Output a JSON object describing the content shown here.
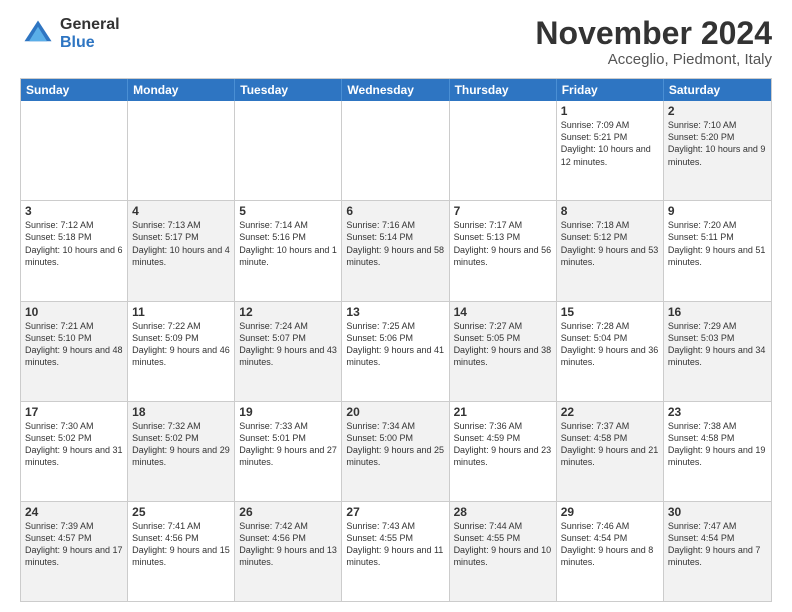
{
  "logo": {
    "line1": "General",
    "line2": "Blue"
  },
  "header": {
    "month": "November 2024",
    "location": "Acceglio, Piedmont, Italy"
  },
  "weekdays": [
    "Sunday",
    "Monday",
    "Tuesday",
    "Wednesday",
    "Thursday",
    "Friday",
    "Saturday"
  ],
  "rows": [
    [
      {
        "day": "",
        "info": "",
        "empty": true
      },
      {
        "day": "",
        "info": "",
        "empty": true
      },
      {
        "day": "",
        "info": "",
        "empty": true
      },
      {
        "day": "",
        "info": "",
        "empty": true
      },
      {
        "day": "",
        "info": "",
        "empty": true
      },
      {
        "day": "1",
        "info": "Sunrise: 7:09 AM\nSunset: 5:21 PM\nDaylight: 10 hours and 12 minutes."
      },
      {
        "day": "2",
        "info": "Sunrise: 7:10 AM\nSunset: 5:20 PM\nDaylight: 10 hours and 9 minutes.",
        "shaded": true
      }
    ],
    [
      {
        "day": "3",
        "info": "Sunrise: 7:12 AM\nSunset: 5:18 PM\nDaylight: 10 hours and 6 minutes."
      },
      {
        "day": "4",
        "info": "Sunrise: 7:13 AM\nSunset: 5:17 PM\nDaylight: 10 hours and 4 minutes.",
        "shaded": true
      },
      {
        "day": "5",
        "info": "Sunrise: 7:14 AM\nSunset: 5:16 PM\nDaylight: 10 hours and 1 minute."
      },
      {
        "day": "6",
        "info": "Sunrise: 7:16 AM\nSunset: 5:14 PM\nDaylight: 9 hours and 58 minutes.",
        "shaded": true
      },
      {
        "day": "7",
        "info": "Sunrise: 7:17 AM\nSunset: 5:13 PM\nDaylight: 9 hours and 56 minutes."
      },
      {
        "day": "8",
        "info": "Sunrise: 7:18 AM\nSunset: 5:12 PM\nDaylight: 9 hours and 53 minutes.",
        "shaded": true
      },
      {
        "day": "9",
        "info": "Sunrise: 7:20 AM\nSunset: 5:11 PM\nDaylight: 9 hours and 51 minutes."
      }
    ],
    [
      {
        "day": "10",
        "info": "Sunrise: 7:21 AM\nSunset: 5:10 PM\nDaylight: 9 hours and 48 minutes.",
        "shaded": true
      },
      {
        "day": "11",
        "info": "Sunrise: 7:22 AM\nSunset: 5:09 PM\nDaylight: 9 hours and 46 minutes."
      },
      {
        "day": "12",
        "info": "Sunrise: 7:24 AM\nSunset: 5:07 PM\nDaylight: 9 hours and 43 minutes.",
        "shaded": true
      },
      {
        "day": "13",
        "info": "Sunrise: 7:25 AM\nSunset: 5:06 PM\nDaylight: 9 hours and 41 minutes."
      },
      {
        "day": "14",
        "info": "Sunrise: 7:27 AM\nSunset: 5:05 PM\nDaylight: 9 hours and 38 minutes.",
        "shaded": true
      },
      {
        "day": "15",
        "info": "Sunrise: 7:28 AM\nSunset: 5:04 PM\nDaylight: 9 hours and 36 minutes."
      },
      {
        "day": "16",
        "info": "Sunrise: 7:29 AM\nSunset: 5:03 PM\nDaylight: 9 hours and 34 minutes.",
        "shaded": true
      }
    ],
    [
      {
        "day": "17",
        "info": "Sunrise: 7:30 AM\nSunset: 5:02 PM\nDaylight: 9 hours and 31 minutes."
      },
      {
        "day": "18",
        "info": "Sunrise: 7:32 AM\nSunset: 5:02 PM\nDaylight: 9 hours and 29 minutes.",
        "shaded": true
      },
      {
        "day": "19",
        "info": "Sunrise: 7:33 AM\nSunset: 5:01 PM\nDaylight: 9 hours and 27 minutes."
      },
      {
        "day": "20",
        "info": "Sunrise: 7:34 AM\nSunset: 5:00 PM\nDaylight: 9 hours and 25 minutes.",
        "shaded": true
      },
      {
        "day": "21",
        "info": "Sunrise: 7:36 AM\nSunset: 4:59 PM\nDaylight: 9 hours and 23 minutes."
      },
      {
        "day": "22",
        "info": "Sunrise: 7:37 AM\nSunset: 4:58 PM\nDaylight: 9 hours and 21 minutes.",
        "shaded": true
      },
      {
        "day": "23",
        "info": "Sunrise: 7:38 AM\nSunset: 4:58 PM\nDaylight: 9 hours and 19 minutes."
      }
    ],
    [
      {
        "day": "24",
        "info": "Sunrise: 7:39 AM\nSunset: 4:57 PM\nDaylight: 9 hours and 17 minutes.",
        "shaded": true
      },
      {
        "day": "25",
        "info": "Sunrise: 7:41 AM\nSunset: 4:56 PM\nDaylight: 9 hours and 15 minutes."
      },
      {
        "day": "26",
        "info": "Sunrise: 7:42 AM\nSunset: 4:56 PM\nDaylight: 9 hours and 13 minutes.",
        "shaded": true
      },
      {
        "day": "27",
        "info": "Sunrise: 7:43 AM\nSunset: 4:55 PM\nDaylight: 9 hours and 11 minutes."
      },
      {
        "day": "28",
        "info": "Sunrise: 7:44 AM\nSunset: 4:55 PM\nDaylight: 9 hours and 10 minutes.",
        "shaded": true
      },
      {
        "day": "29",
        "info": "Sunrise: 7:46 AM\nSunset: 4:54 PM\nDaylight: 9 hours and 8 minutes."
      },
      {
        "day": "30",
        "info": "Sunrise: 7:47 AM\nSunset: 4:54 PM\nDaylight: 9 hours and 7 minutes.",
        "shaded": true
      }
    ]
  ]
}
